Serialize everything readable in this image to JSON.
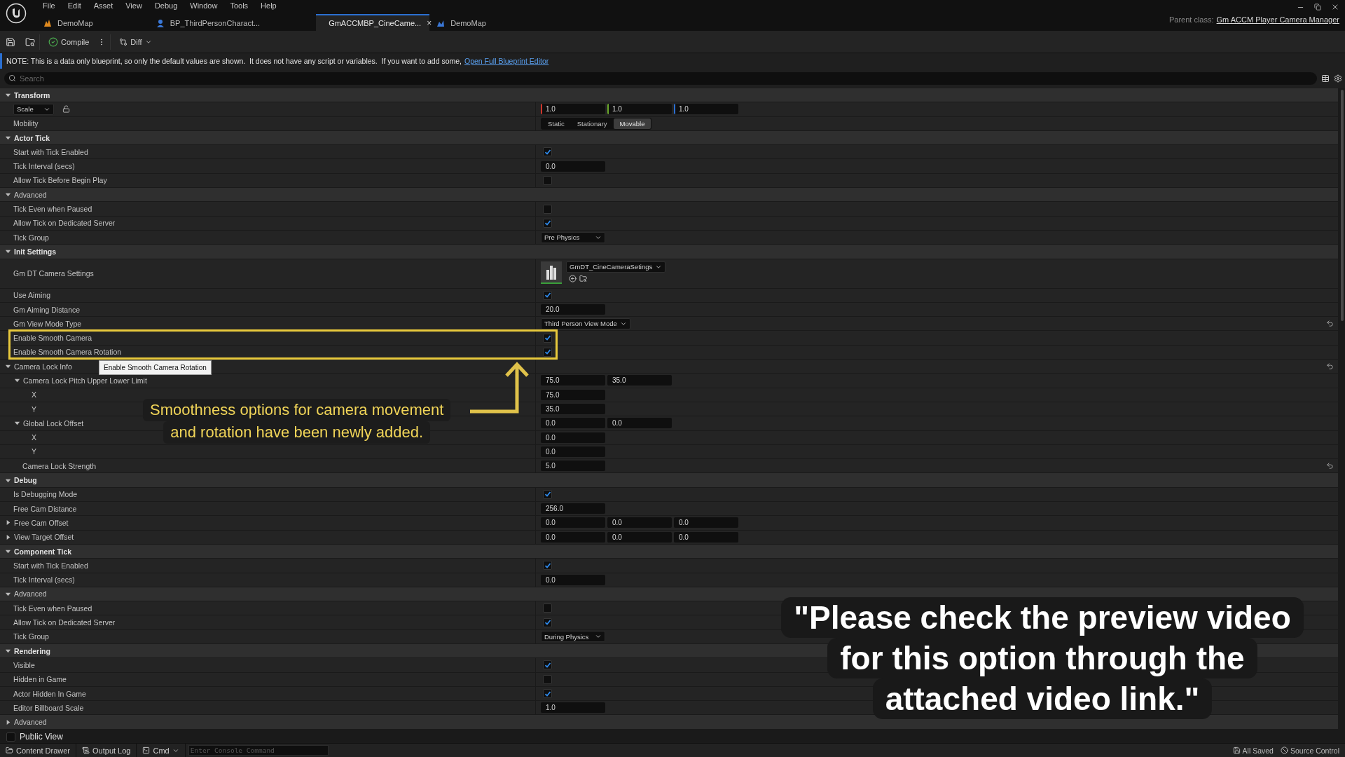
{
  "window": {
    "menu": [
      "File",
      "Edit",
      "Asset",
      "View",
      "Debug",
      "Window",
      "Tools",
      "Help"
    ],
    "tabs": [
      {
        "label": "DemoMap",
        "kind": "level",
        "selected": false
      },
      {
        "label": "BP_ThirdPersonCharact...",
        "kind": "blueprint",
        "selected": false
      },
      {
        "label": "GmACCMBP_CineCame...",
        "kind": "blueprint",
        "selected": true,
        "close": "×"
      },
      {
        "label": "DemoMap",
        "kind": "map",
        "selected": false
      }
    ],
    "parent_class": {
      "label": "Parent class:",
      "value": "Gm ACCM Player Camera Manager"
    }
  },
  "toolbar": {
    "compile": "Compile",
    "diff": "Diff"
  },
  "note": {
    "text": "NOTE: This is a data only blueprint, so only the default values are shown.  It does not have any script or variables.  If you want to add some,",
    "link": "Open Full Blueprint Editor"
  },
  "search": {
    "placeholder": "Search"
  },
  "properties": [
    {
      "kind": "section",
      "label": "Transform",
      "expanded": true,
      "children": [
        {
          "kind": "scale",
          "label": "Scale",
          "values": [
            "1.0",
            "1.0",
            "1.0"
          ]
        },
        {
          "kind": "segment",
          "label": "Mobility",
          "options": [
            {
              "label": "Static",
              "selected": false
            },
            {
              "label": "Stationary",
              "selected": false
            },
            {
              "label": "Movable",
              "selected": true
            }
          ]
        }
      ]
    },
    {
      "kind": "section",
      "label": "Actor Tick",
      "expanded": true,
      "children": [
        {
          "kind": "check",
          "label": "Start with Tick Enabled",
          "checked": true
        },
        {
          "kind": "number",
          "label": "Tick Interval (secs)",
          "values": [
            "0.0"
          ]
        },
        {
          "kind": "check",
          "label": "Allow Tick Before Begin Play",
          "checked": false
        },
        {
          "kind": "subsection",
          "label": "Advanced",
          "expanded": true,
          "children": [
            {
              "kind": "check",
              "label": "Tick Even when Paused",
              "checked": false
            },
            {
              "kind": "check",
              "label": "Allow Tick on Dedicated Server",
              "checked": true
            },
            {
              "kind": "dropdown",
              "label": "Tick Group",
              "value": "Pre Physics"
            }
          ]
        }
      ]
    },
    {
      "kind": "section",
      "label": "Init Settings",
      "expanded": true,
      "children": [
        {
          "kind": "asset",
          "label": "Gm DT Camera Settings",
          "value": "GmDT_CineCameraSetings"
        },
        {
          "kind": "check",
          "label": "Use Aiming",
          "checked": true
        },
        {
          "kind": "number",
          "label": "Gm Aiming Distance",
          "values": [
            "20.0"
          ]
        },
        {
          "kind": "dropdown",
          "label": "Gm View Mode Type",
          "value": "Third Person View Mode",
          "resettable": true
        },
        {
          "kind": "highlight",
          "tooltip": "Enable Smooth Camera Rotation",
          "children": [
            {
              "kind": "check",
              "label": "Enable Smooth Camera",
              "checked": true
            },
            {
              "kind": "check",
              "label": "Enable Smooth Camera Rotation",
              "checked": true
            }
          ]
        },
        {
          "kind": "group",
          "label": "Camera Lock Info",
          "expanded": true,
          "resettable": true,
          "children": [
            {
              "kind": "group",
              "label": "Camera Lock Pitch Upper Lower Limit",
              "expanded": true,
              "values": [
                "75.0",
                "35.0"
              ],
              "children": [
                {
                  "kind": "number",
                  "label": "X",
                  "values": [
                    "75.0"
                  ]
                },
                {
                  "kind": "number",
                  "label": "Y",
                  "values": [
                    "35.0"
                  ]
                }
              ]
            },
            {
              "kind": "group",
              "label": "Global Lock Offset",
              "expanded": true,
              "values": [
                "0.0",
                "0.0"
              ],
              "children": [
                {
                  "kind": "number",
                  "label": "X",
                  "values": [
                    "0.0"
                  ]
                },
                {
                  "kind": "number",
                  "label": "Y",
                  "values": [
                    "0.0"
                  ]
                }
              ]
            },
            {
              "kind": "number",
              "label": "Camera Lock Strength",
              "values": [
                "5.0"
              ],
              "resettable": true
            }
          ]
        }
      ]
    },
    {
      "kind": "section",
      "label": "Debug",
      "expanded": true,
      "children": [
        {
          "kind": "check",
          "label": "Is Debugging Mode",
          "checked": true
        },
        {
          "kind": "number",
          "label": "Free Cam Distance",
          "values": [
            "256.0"
          ]
        },
        {
          "kind": "group",
          "label": "Free Cam Offset",
          "expanded": false,
          "values": [
            "0.0",
            "0.0",
            "0.0"
          ]
        },
        {
          "kind": "group",
          "label": "View Target Offset",
          "expanded": false,
          "values": [
            "0.0",
            "0.0",
            "0.0"
          ]
        }
      ]
    },
    {
      "kind": "section",
      "label": "Component Tick",
      "expanded": true,
      "children": [
        {
          "kind": "check",
          "label": "Start with Tick Enabled",
          "checked": true
        },
        {
          "kind": "number",
          "label": "Tick Interval (secs)",
          "values": [
            "0.0"
          ]
        },
        {
          "kind": "subsection",
          "label": "Advanced",
          "expanded": true,
          "children": [
            {
              "kind": "check",
              "label": "Tick Even when Paused",
              "checked": false
            },
            {
              "kind": "check",
              "label": "Allow Tick on Dedicated Server",
              "checked": true
            },
            {
              "kind": "dropdown",
              "label": "Tick Group",
              "value": "During Physics"
            }
          ]
        }
      ]
    },
    {
      "kind": "section",
      "label": "Rendering",
      "expanded": true,
      "children": [
        {
          "kind": "check",
          "label": "Visible",
          "checked": true
        },
        {
          "kind": "check",
          "label": "Hidden in Game",
          "checked": false
        },
        {
          "kind": "check",
          "label": "Actor Hidden In Game",
          "checked": true
        },
        {
          "kind": "number",
          "label": "Editor Billboard Scale",
          "values": [
            "1.0"
          ]
        },
        {
          "kind": "subsection",
          "label": "Advanced",
          "expanded": false
        }
      ]
    }
  ],
  "public_view": {
    "label": "Public View",
    "checked": false
  },
  "annotation": {
    "lines": [
      "Smoothness options for camera movement",
      "and rotation have been newly added."
    ]
  },
  "caption": {
    "lines": [
      "\"Please check the preview video",
      "for this option through the",
      "attached video link.\""
    ]
  },
  "status_bar": {
    "content_drawer": "Content Drawer",
    "output_log": "Output Log",
    "cmd": "Cmd",
    "console_placeholder": "Enter Console Command",
    "saved": "All Saved",
    "source_control": "Source Control"
  }
}
